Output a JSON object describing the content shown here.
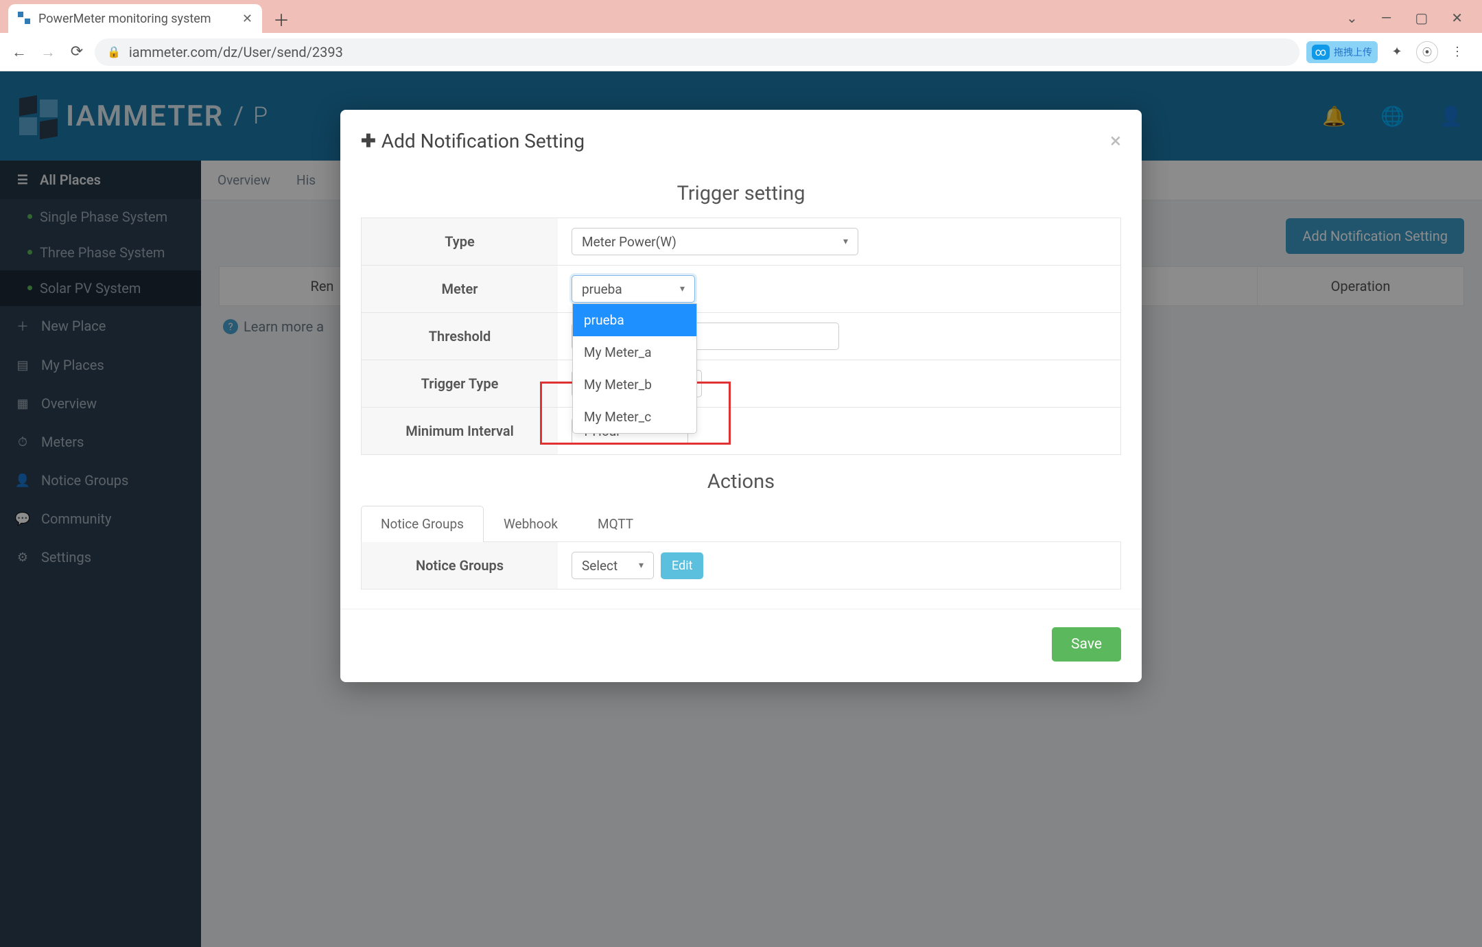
{
  "browser": {
    "tab_title": "PowerMeter monitoring system",
    "url": "iammeter.com/dz/User/send/2393",
    "cloud_ext_label": "拖拽上传"
  },
  "header": {
    "logo_text": "IAMMETER",
    "page_prefix": "P"
  },
  "sidebar": {
    "all_places": "All Places",
    "places": [
      {
        "label": "Single Phase System"
      },
      {
        "label": "Three Phase System"
      },
      {
        "label": "Solar PV System"
      }
    ],
    "items": [
      {
        "icon": "＋",
        "label": "New Place"
      },
      {
        "icon": "▤",
        "label": "My Places"
      },
      {
        "icon": "▦",
        "label": "Overview"
      },
      {
        "icon": "⏱",
        "label": "Meters"
      },
      {
        "icon": "👤",
        "label": "Notice Groups"
      },
      {
        "icon": "💬",
        "label": "Community"
      },
      {
        "icon": "⚙",
        "label": "Settings"
      }
    ]
  },
  "main": {
    "tabs": [
      "Overview",
      "His"
    ],
    "add_button": "Add Notification Setting",
    "table_cols": {
      "remarks": "Ren",
      "operation": "Operation"
    },
    "learn_more": "Learn more a"
  },
  "modal": {
    "title": "Add Notification Setting",
    "trigger_heading": "Trigger setting",
    "rows": {
      "type": {
        "label": "Type",
        "value": "Meter Power(W)"
      },
      "meter": {
        "label": "Meter",
        "value": "prueba"
      },
      "threshold": {
        "label": "Threshold"
      },
      "trigger_type": {
        "label": "Trigger Type"
      },
      "min_interval": {
        "label": "Minimum Interval",
        "value": "1 Hour"
      }
    },
    "meter_options": [
      "prueba",
      "My Meter_a",
      "My Meter_b",
      "My Meter_c"
    ],
    "actions_heading": "Actions",
    "action_tabs": [
      "Notice Groups",
      "Webhook",
      "MQTT"
    ],
    "notice_groups": {
      "label": "Notice Groups",
      "select": "Select",
      "edit": "Edit"
    },
    "save": "Save"
  }
}
